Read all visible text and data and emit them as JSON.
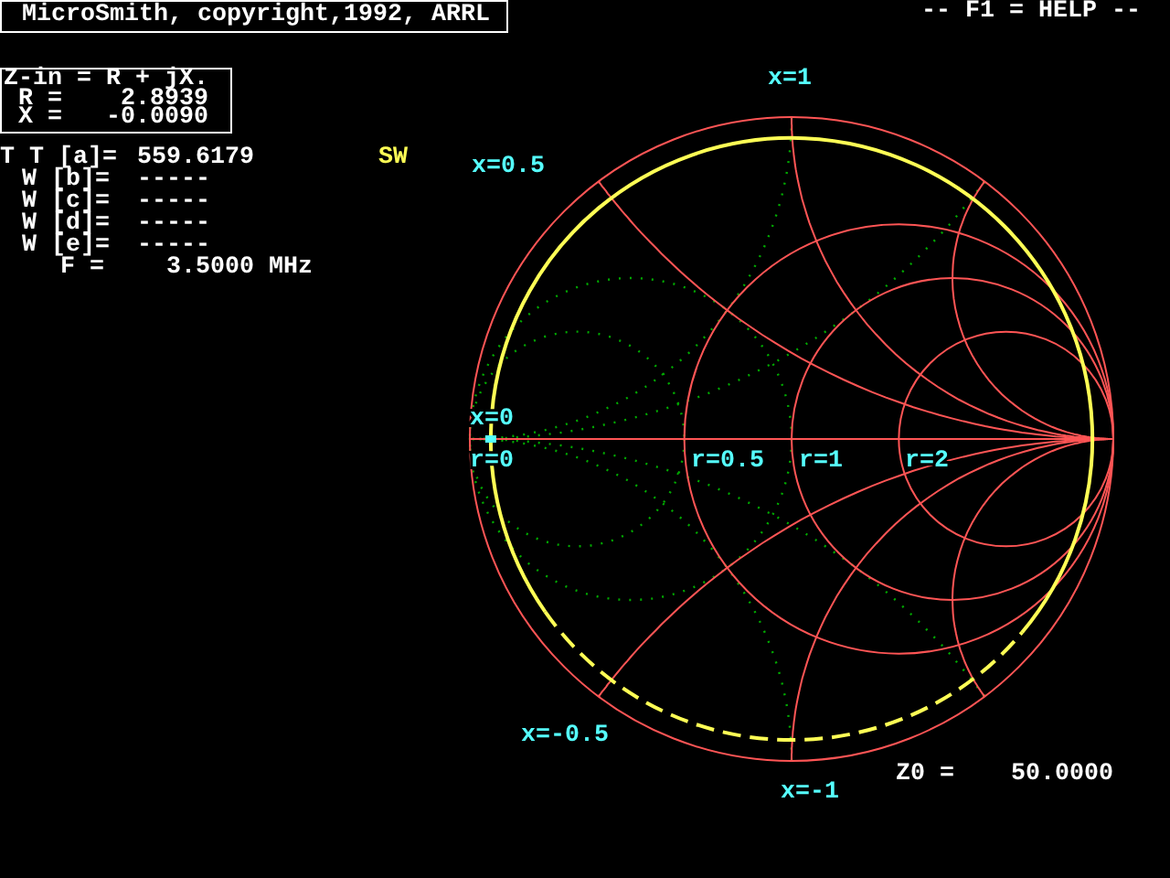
{
  "title_bar": {
    "title": "MicroSmith, copyright,1992, ARRL",
    "help": "-- F1 = HELP --"
  },
  "impedance_box": {
    "heading": "Z-in = R + jX.",
    "rows": [
      {
        "label": "R =",
        "value": "2.8939"
      },
      {
        "label": "X =",
        "value": "-0.0090"
      }
    ]
  },
  "lines": [
    {
      "kind": "line",
      "label": "T T [a]=",
      "value": "559.6179",
      "tag": "SW"
    },
    {
      "kind": "element",
      "label": "W [b]=",
      "value": "-----"
    },
    {
      "kind": "element",
      "label": "W [c]=",
      "value": "-----"
    },
    {
      "kind": "element",
      "label": "W [d]=",
      "value": "-----"
    },
    {
      "kind": "element",
      "label": "W [e]=",
      "value": "-----"
    }
  ],
  "frequency": {
    "label": "F =",
    "value": "3.5000",
    "unit": "MHz"
  },
  "chart": {
    "labels": [
      {
        "text": "x=1"
      },
      {
        "text": "x=0.5"
      },
      {
        "text": "x=0"
      },
      {
        "text": "r=0"
      },
      {
        "text": "r=0.5"
      },
      {
        "text": "r=1"
      },
      {
        "text": "r=2"
      },
      {
        "text": "x=-0.5"
      },
      {
        "text": "x=-1"
      }
    ],
    "z0": {
      "label": "Z0 =",
      "value": "50.0000"
    }
  }
}
